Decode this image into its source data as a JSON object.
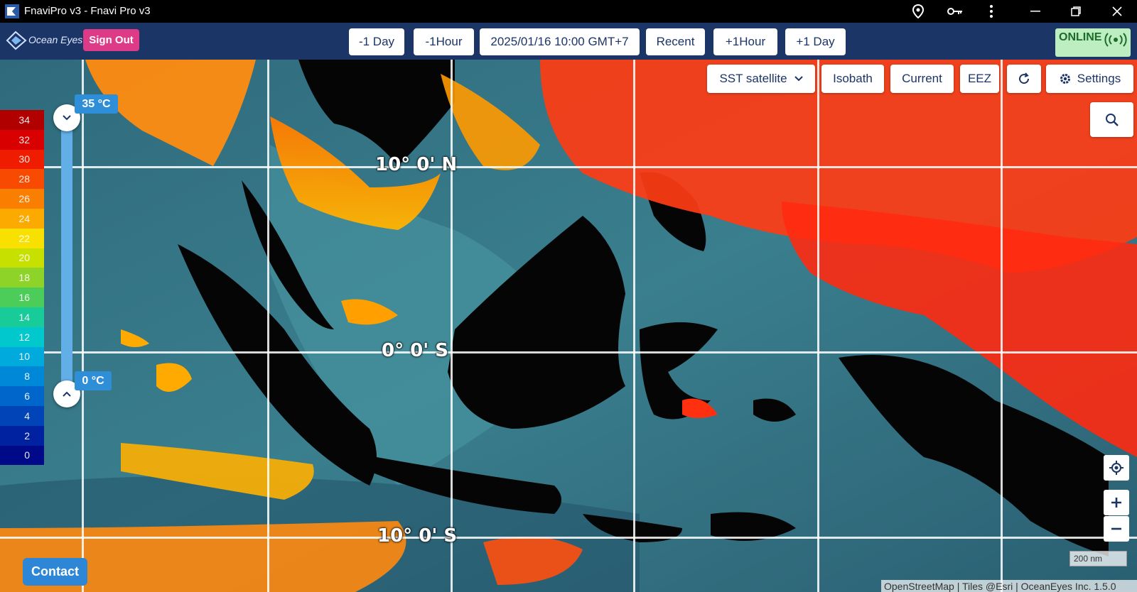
{
  "window": {
    "title": "FnaviPro v3 - Fnavi Pro v3",
    "controls": [
      "location-icon",
      "key-icon",
      "more-vertical-icon",
      "minimize-icon",
      "restore-icon",
      "close-icon"
    ]
  },
  "toolbar": {
    "logo_text": "Ocean Eyes",
    "sign_out": "Sign Out",
    "minus_day": "-1 Day",
    "minus_hour": "-1Hour",
    "datetime": "2025/01/16 10:00 GMT+7",
    "recent": "Recent",
    "plus_hour": "+1Hour",
    "plus_day": "+1 Day",
    "status": "ONLINE",
    "status_color": "#bdeec1"
  },
  "layers": {
    "sst": "SST satellite",
    "isobath": "Isobath",
    "current": "Current",
    "eez": "EEZ",
    "settings": "Settings"
  },
  "legend": {
    "values": [
      "34",
      "32",
      "30",
      "28",
      "26",
      "24",
      "22",
      "20",
      "18",
      "16",
      "14",
      "12",
      "10",
      "8",
      "6",
      "4",
      "2",
      "0"
    ],
    "colors": [
      "#b00000",
      "#d80000",
      "#f01c00",
      "#f84a00",
      "#fa7e00",
      "#fcaa00",
      "#f8e000",
      "#c8e000",
      "#8ed428",
      "#4ccc58",
      "#18cc9a",
      "#00c8cc",
      "#00aadc",
      "#0088d8",
      "#0066cc",
      "#0044b8",
      "#0022a0",
      "#000a88"
    ],
    "max_label": "35 °C",
    "min_label": "0 °C"
  },
  "map": {
    "lat_labels": [
      "10° 0' N",
      "0° 0' S",
      "10° 0' S"
    ],
    "scale": "200 nm",
    "attribution": "OpenStreetMap | Tiles @Esri | OceanEyes Inc. 1.5.0"
  },
  "contact": "Contact"
}
